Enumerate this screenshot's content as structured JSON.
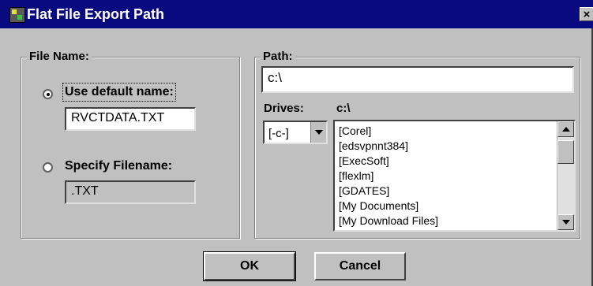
{
  "window": {
    "title": "Flat File Export Path",
    "close_glyph": "×",
    "app_icon": "app-icon"
  },
  "file_name_group": {
    "legend": "File Name:",
    "use_default": {
      "label": "Use default name:",
      "checked": true,
      "value": "RVCTDATA.TXT"
    },
    "specify": {
      "label": "Specify Filename:",
      "checked": false,
      "value": ".TXT"
    }
  },
  "path_group": {
    "legend": "Path:",
    "path_value": "c:\\",
    "drives_label": "Drives:",
    "current_drive_path": "c:\\",
    "drive_selected": "[-c-]",
    "directories": [
      "[Corel]",
      "[edsvpnnt384]",
      "[ExecSoft]",
      "[flexlm]",
      "[GDATES]",
      "[My Documents]",
      "[My Download Files]"
    ]
  },
  "buttons": {
    "ok": "OK",
    "cancel": "Cancel"
  }
}
